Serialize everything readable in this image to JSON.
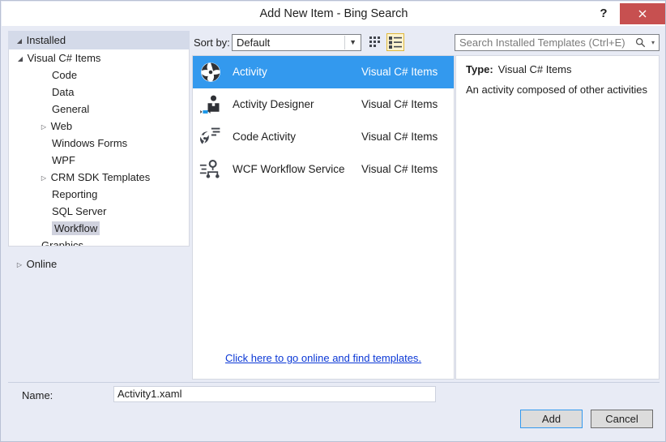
{
  "window": {
    "title": "Add New Item - Bing Search",
    "help_label": "?",
    "close_label": "✕"
  },
  "sidebar": {
    "installed": {
      "label": "Installed",
      "expander": "◢"
    },
    "online": {
      "label": "Online",
      "expander": "▷"
    },
    "nodes": [
      {
        "label": "Visual C# Items",
        "level": 1,
        "expander": "◢",
        "selected": false
      },
      {
        "label": "Code",
        "level": 2,
        "expander": "",
        "selected": false
      },
      {
        "label": "Data",
        "level": 2,
        "expander": "",
        "selected": false
      },
      {
        "label": "General",
        "level": 2,
        "expander": "",
        "selected": false
      },
      {
        "label": "Web",
        "level": 2,
        "expander": "▷",
        "selected": false
      },
      {
        "label": "Windows Forms",
        "level": 2,
        "expander": "",
        "selected": false
      },
      {
        "label": "WPF",
        "level": 2,
        "expander": "",
        "selected": false
      },
      {
        "label": "CRM SDK Templates",
        "level": 2,
        "expander": "▷",
        "selected": false
      },
      {
        "label": "Reporting",
        "level": 2,
        "expander": "",
        "selected": false
      },
      {
        "label": "SQL Server",
        "level": 2,
        "expander": "",
        "selected": false
      },
      {
        "label": "Workflow",
        "level": 2,
        "expander": "",
        "selected": true
      },
      {
        "label": "Graphics",
        "level": 1,
        "expander": "",
        "selected": false
      }
    ]
  },
  "toolbar": {
    "sort_by_label": "Sort by:",
    "sort_by_value": "Default",
    "sort_by_caret": "▼",
    "grid_view_icon": "grid-view-icon",
    "list_view_icon": "list-view-icon",
    "list_view_selected": true
  },
  "search": {
    "placeholder": "Search Installed Templates (Ctrl+E)",
    "icon": "search-icon",
    "caret": "▾"
  },
  "templates": {
    "items": [
      {
        "name": "Activity",
        "category": "Visual C# Items",
        "icon": "activity-pinwheel-icon",
        "selected": true
      },
      {
        "name": "Activity Designer",
        "category": "Visual C# Items",
        "icon": "activity-designer-icon",
        "selected": false
      },
      {
        "name": "Code Activity",
        "category": "Visual C# Items",
        "icon": "code-activity-icon",
        "selected": false
      },
      {
        "name": "WCF Workflow Service",
        "category": "Visual C# Items",
        "icon": "wcf-workflow-service-icon",
        "selected": false
      }
    ],
    "online_link": "Click here to go online and find templates."
  },
  "details": {
    "type_label": "Type:",
    "type_value": "Visual C# Items",
    "description": "An activity composed of other activities"
  },
  "footer": {
    "name_label": "Name:",
    "name_value": "Activity1.xaml",
    "add_label": "Add",
    "cancel_label": "Cancel"
  },
  "colors": {
    "selection_blue": "#3399ee",
    "close_red": "#c75050",
    "link_blue": "#0b38d6",
    "toggle_gold": "#e0b83c",
    "dialog_bg": "#e8ebf5"
  }
}
